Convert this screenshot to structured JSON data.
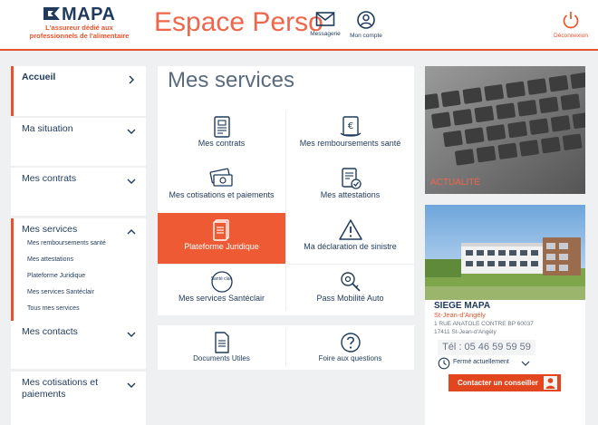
{
  "header": {
    "logo_word": "MAPA",
    "logo_tagline": "L'assureur dédié aux professionnels de l'alimentaire",
    "site_title": "Espace Perso",
    "messagerie_label": "Messagerie",
    "account_label": "Mon compte",
    "logout_label": "Déconnexion"
  },
  "sidebar": {
    "accueil": "Accueil",
    "situation": "Ma situation",
    "contrats": "Mes contrats",
    "services": "Mes services",
    "services_sub": [
      "Mes remboursements santé",
      "Mes attestations",
      "Plateforme Juridique",
      "Mes services Santéclair",
      "Tous mes services"
    ],
    "contacts": "Mes contacts",
    "cotisations": "Mes cotisations et paiements"
  },
  "services": {
    "title": "Mes services",
    "items": [
      "Mes contrats",
      "Mes remboursements santé",
      "Mes cotisations et paiements",
      "Mes attestations",
      "Plateforme Juridique",
      "Ma déclaration de sinistre",
      "Mes services Santéclair",
      "Pass Mobilité Auto"
    ],
    "santeclair_logo": "Santé clair",
    "docs": "Documents Utiles",
    "faq": "Foire aux questions"
  },
  "news": {
    "label": "ACTUALITÉ"
  },
  "office": {
    "name": "SIEGE MAPA",
    "city": "St-Jean-d'Angély",
    "address1": "1 RUE ANATOLE CONTRE BP 60037",
    "address2": "17411 St-Jean-d'Angély",
    "phone": "Tél : 05 46 59 59 59",
    "hours": "Fermé actuellement",
    "contact_button": "Contacter un conseiller"
  },
  "colors": {
    "brand_orange": "#e8532b",
    "navy": "#1f3a5c",
    "background": "#eef0f2"
  }
}
